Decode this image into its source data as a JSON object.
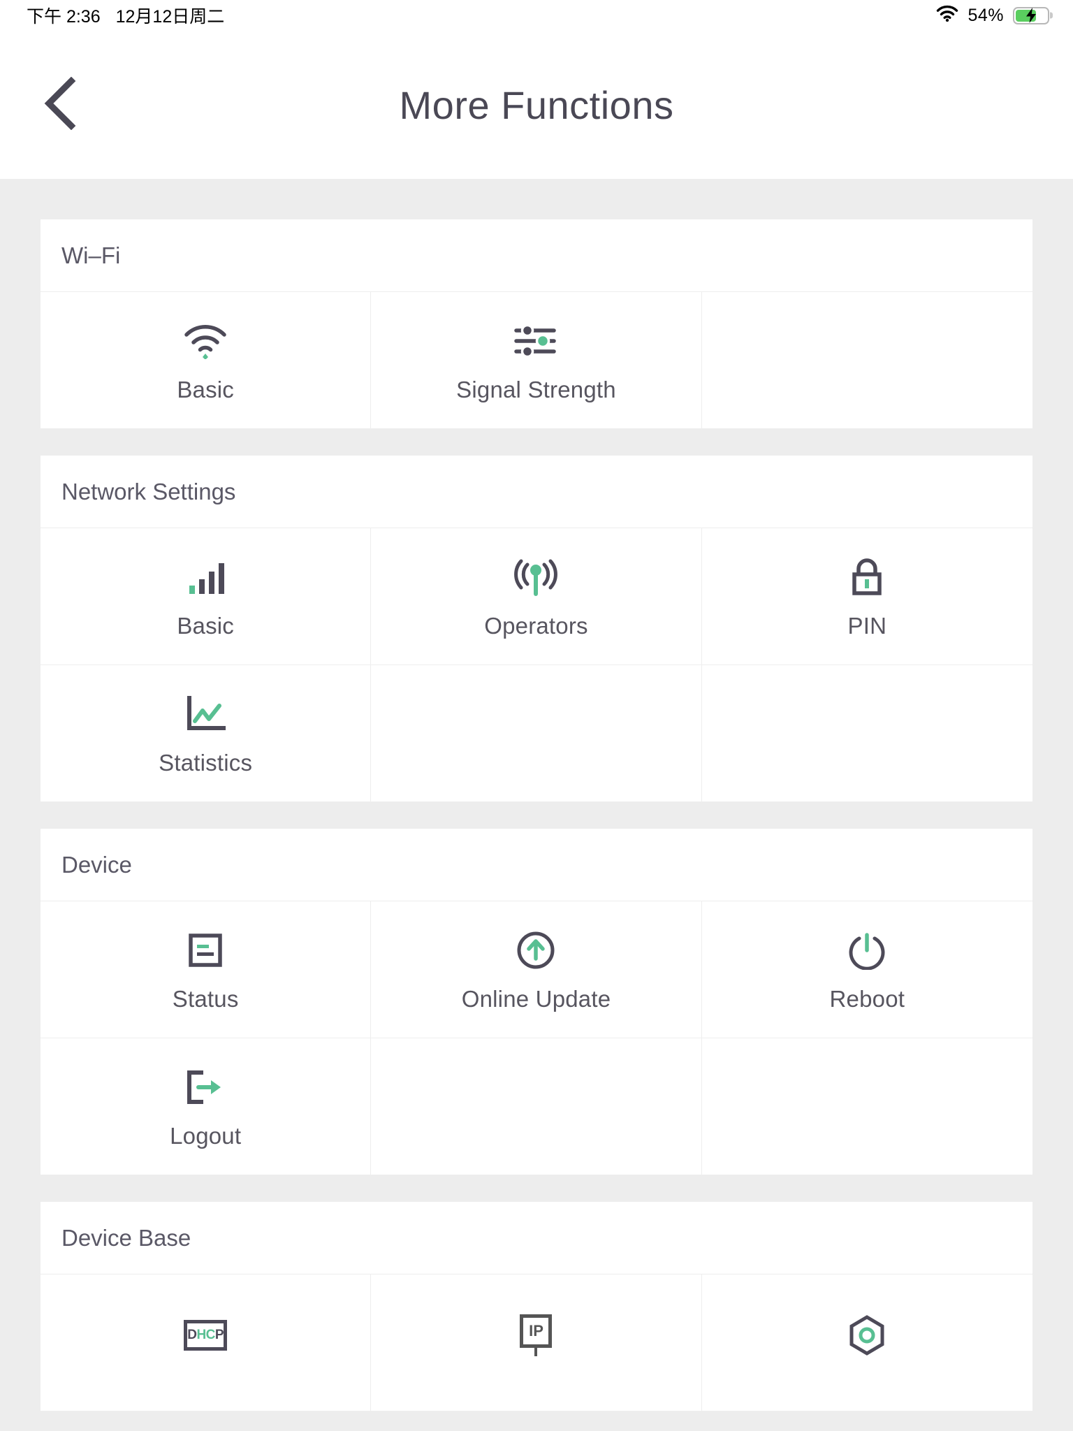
{
  "status_bar": {
    "time": "下午 2:36",
    "date": "12月12日周二",
    "wifi_icon": "wifi-icon",
    "battery_percent": "54%",
    "battery_state": "charging"
  },
  "header": {
    "back_icon": "chevron-left-icon",
    "title": "More Functions"
  },
  "theme": {
    "accent": "#58bf92",
    "dark": "#4d4a58",
    "page_bg": "#ededed",
    "card_bg": "#ffffff",
    "text": "#57555f"
  },
  "sections": [
    {
      "title": "Wi–Fi",
      "tiles": [
        {
          "label": "Basic",
          "icon": "wifi-icon"
        },
        {
          "label": "Signal Strength",
          "icon": "sliders-icon"
        },
        {
          "label": "",
          "icon": ""
        }
      ]
    },
    {
      "title": "Network Settings",
      "tiles": [
        {
          "label": "Basic",
          "icon": "signal-bars-icon"
        },
        {
          "label": "Operators",
          "icon": "antenna-icon"
        },
        {
          "label": "PIN",
          "icon": "lock-icon"
        },
        {
          "label": "Statistics",
          "icon": "line-chart-icon"
        },
        {
          "label": "",
          "icon": ""
        },
        {
          "label": "",
          "icon": ""
        }
      ]
    },
    {
      "title": "Device",
      "tiles": [
        {
          "label": "Status",
          "icon": "document-lines-icon"
        },
        {
          "label": "Online Update",
          "icon": "arrow-up-circle-icon"
        },
        {
          "label": "Reboot",
          "icon": "power-icon"
        },
        {
          "label": "Logout",
          "icon": "logout-arrow-icon"
        },
        {
          "label": "",
          "icon": ""
        },
        {
          "label": "",
          "icon": ""
        }
      ]
    },
    {
      "title": "Device Base",
      "tiles": [
        {
          "label": "",
          "icon": "dhcp-icon"
        },
        {
          "label": "",
          "icon": "ip-icon"
        },
        {
          "label": "",
          "icon": "hexagon-icon"
        }
      ]
    }
  ]
}
